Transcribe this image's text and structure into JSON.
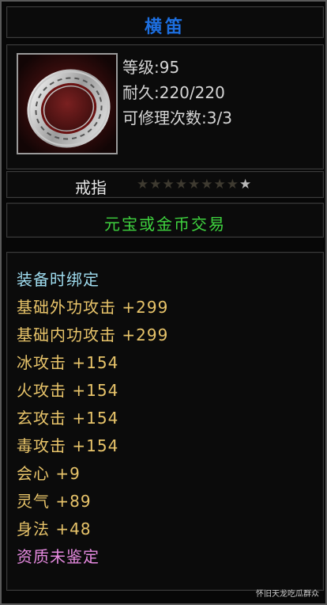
{
  "item": {
    "name": "横笛",
    "level": "等级:95",
    "durability": "耐久:220/220",
    "repair": "可修理次数:3/3",
    "type": "戒指",
    "star_rating": {
      "max": 9,
      "value": 1
    },
    "trade": "元宝或金币交易"
  },
  "attributes": [
    {
      "text": "装备时绑定",
      "color": "cyan"
    },
    {
      "text": "基础外功攻击 +299",
      "color": "yellow"
    },
    {
      "text": "基础内功攻击 +299",
      "color": "yellow"
    },
    {
      "text": "冰攻击 +154",
      "color": "yellow"
    },
    {
      "text": "火攻击 +154",
      "color": "yellow"
    },
    {
      "text": "玄攻击 +154",
      "color": "yellow"
    },
    {
      "text": "毒攻击 +154",
      "color": "yellow"
    },
    {
      "text": "会心 +9",
      "color": "yellow"
    },
    {
      "text": "灵气 +89",
      "color": "yellow"
    },
    {
      "text": "身法 +48",
      "color": "yellow"
    },
    {
      "text": "资质未鉴定",
      "color": "pink"
    }
  ],
  "colors": {
    "title": "#1d6fe0",
    "trade": "#3fd43f",
    "cyan": "#9fdcef",
    "yellow": "#e8c46a",
    "pink": "#e68ae0"
  },
  "watermark": "怀旧天龙吃瓜群众"
}
